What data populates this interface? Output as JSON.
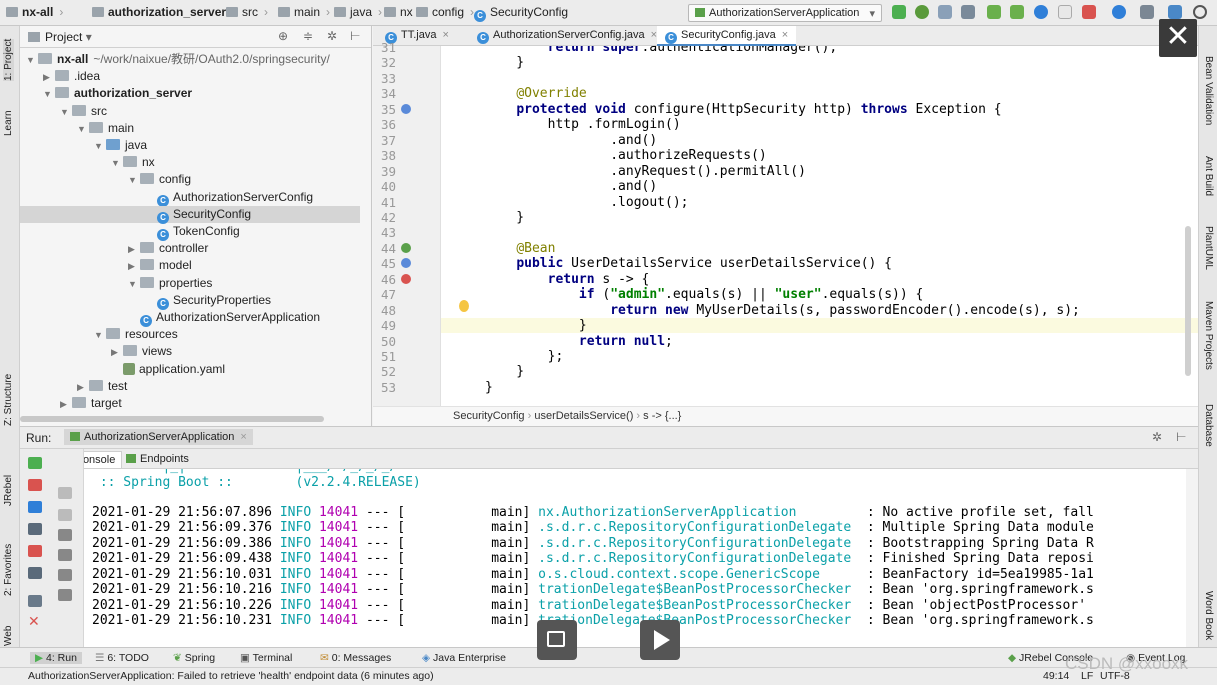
{
  "breadcrumb": [
    "nx-all",
    "authorization_server",
    "src",
    "main",
    "java",
    "nx",
    "config",
    "SecurityConfig"
  ],
  "run_config": "AuthorizationServerApplication",
  "project_panel": {
    "title": "Project",
    "tree": [
      {
        "label": "nx-all",
        "extra": "~/work/naixue/教研/OAuth2.0/springsecurity/",
        "indent": 0,
        "arrow": "▼",
        "icon": "folder",
        "bold": true
      },
      {
        "label": ".idea",
        "indent": 1,
        "arrow": "▶",
        "icon": "folder"
      },
      {
        "label": "authorization_server",
        "indent": 1,
        "arrow": "▼",
        "icon": "folder",
        "bold": true
      },
      {
        "label": "src",
        "indent": 2,
        "arrow": "▼",
        "icon": "folder"
      },
      {
        "label": "main",
        "indent": 3,
        "arrow": "▼",
        "icon": "folder"
      },
      {
        "label": "java",
        "indent": 4,
        "arrow": "▼",
        "icon": "folder-blue"
      },
      {
        "label": "nx",
        "indent": 5,
        "arrow": "▼",
        "icon": "folder"
      },
      {
        "label": "config",
        "indent": 6,
        "arrow": "▼",
        "icon": "folder"
      },
      {
        "label": "AuthorizationServerConfig",
        "indent": 7,
        "arrow": "",
        "icon": "class"
      },
      {
        "label": "SecurityConfig",
        "indent": 7,
        "arrow": "",
        "icon": "class",
        "selected": true
      },
      {
        "label": "TokenConfig",
        "indent": 7,
        "arrow": "",
        "icon": "class"
      },
      {
        "label": "controller",
        "indent": 6,
        "arrow": "▶",
        "icon": "folder"
      },
      {
        "label": "model",
        "indent": 6,
        "arrow": "▶",
        "icon": "folder"
      },
      {
        "label": "properties",
        "indent": 6,
        "arrow": "▼",
        "icon": "folder"
      },
      {
        "label": "SecurityProperties",
        "indent": 7,
        "arrow": "",
        "icon": "class"
      },
      {
        "label": "AuthorizationServerApplication",
        "indent": 6,
        "arrow": "",
        "icon": "class"
      },
      {
        "label": "resources",
        "indent": 4,
        "arrow": "▼",
        "icon": "folder"
      },
      {
        "label": "views",
        "indent": 5,
        "arrow": "▶",
        "icon": "folder"
      },
      {
        "label": "application.yaml",
        "indent": 5,
        "arrow": "",
        "icon": "yaml"
      },
      {
        "label": "test",
        "indent": 3,
        "arrow": "▶",
        "icon": "folder"
      },
      {
        "label": "target",
        "indent": 2,
        "arrow": "▶",
        "icon": "folder"
      }
    ]
  },
  "editor_tabs": [
    {
      "label": "TT.java",
      "active": false
    },
    {
      "label": "AuthorizationServerConfig.java",
      "active": false
    },
    {
      "label": "SecurityConfig.java",
      "active": true
    }
  ],
  "code_lines": [
    {
      "n": "31",
      "html": "        <span class='kw'>return super</span>.authenticationManager();"
    },
    {
      "n": "32",
      "html": "    }"
    },
    {
      "n": "33",
      "html": ""
    },
    {
      "n": "34",
      "html": "    <span class='an'>@Override</span>"
    },
    {
      "n": "35",
      "html": "    <span class='kw'>protected void</span> configure(HttpSecurity http) <span class='kw'>throws</span> Exception {"
    },
    {
      "n": "36",
      "html": "        http .formLogin()"
    },
    {
      "n": "37",
      "html": "                .and()"
    },
    {
      "n": "38",
      "html": "                .authorizeRequests()"
    },
    {
      "n": "39",
      "html": "                .anyRequest().permitAll()"
    },
    {
      "n": "40",
      "html": "                .and()"
    },
    {
      "n": "41",
      "html": "                .logout();"
    },
    {
      "n": "42",
      "html": "    }"
    },
    {
      "n": "43",
      "html": ""
    },
    {
      "n": "44",
      "html": "    <span class='an'>@Bean</span>"
    },
    {
      "n": "45",
      "html": "    <span class='kw'>public</span> UserDetailsService userDetailsService() {"
    },
    {
      "n": "46",
      "html": "        <span class='kw'>return</span> s -> {"
    },
    {
      "n": "47",
      "html": "            <span class='kw'>if</span> (<span class='st'>\"admin\"</span>.equals(s) || <span class='st'>\"user\"</span>.equals(s)) {"
    },
    {
      "n": "48",
      "html": "                <span class='kw'>return new</span> MyUserDetails(s, passwordEncoder().encode(s), s);"
    },
    {
      "n": "49",
      "html": "            }"
    },
    {
      "n": "50",
      "html": "            <span class='kw'>return null</span>;"
    },
    {
      "n": "51",
      "html": "        };"
    },
    {
      "n": "52",
      "html": "    }"
    },
    {
      "n": "53",
      "html": "}"
    }
  ],
  "editor_breadcrumb": [
    "SecurityConfig",
    "userDetailsService()",
    "s -> {...}"
  ],
  "run_panel": {
    "label": "Run:",
    "config": "AuthorizationServerApplication",
    "tabs": [
      "Console",
      "Endpoints"
    ],
    "banner_line": "=========|_|==============|___/=/_/_/_/",
    "boot_line": " :: Spring Boot ::        (v2.2.4.RELEASE)",
    "logs": [
      {
        "ts": "2021-01-29 21:56:07.896",
        "lvl": "INFO",
        "pid": "14041",
        "sep": "--- [",
        "thread": "main]",
        "logger": "nx.AuthorizationServerApplication        ",
        "msg": ": No active profile set, fall"
      },
      {
        "ts": "2021-01-29 21:56:09.376",
        "lvl": "INFO",
        "pid": "14041",
        "sep": "--- [",
        "thread": "main]",
        "logger": ".s.d.r.c.RepositoryConfigurationDelegate ",
        "msg": ": Multiple Spring Data module"
      },
      {
        "ts": "2021-01-29 21:56:09.386",
        "lvl": "INFO",
        "pid": "14041",
        "sep": "--- [",
        "thread": "main]",
        "logger": ".s.d.r.c.RepositoryConfigurationDelegate ",
        "msg": ": Bootstrapping Spring Data R"
      },
      {
        "ts": "2021-01-29 21:56:09.438",
        "lvl": "INFO",
        "pid": "14041",
        "sep": "--- [",
        "thread": "main]",
        "logger": ".s.d.r.c.RepositoryConfigurationDelegate ",
        "msg": ": Finished Spring Data reposi"
      },
      {
        "ts": "2021-01-29 21:56:10.031",
        "lvl": "INFO",
        "pid": "14041",
        "sep": "--- [",
        "thread": "main]",
        "logger": "o.s.cloud.context.scope.GenericScope     ",
        "msg": ": BeanFactory id=5ea19985-1a1"
      },
      {
        "ts": "2021-01-29 21:56:10.216",
        "lvl": "INFO",
        "pid": "14041",
        "sep": "--- [",
        "thread": "main]",
        "logger": "trationDelegate$BeanPostProcessorChecker ",
        "msg": ": Bean 'org.springframework.s"
      },
      {
        "ts": "2021-01-29 21:56:10.226",
        "lvl": "INFO",
        "pid": "14041",
        "sep": "--- [",
        "thread": "main]",
        "logger": "trationDelegate$BeanPostProcessorChecker ",
        "msg": ": Bean 'objectPostProcessor'"
      },
      {
        "ts": "2021-01-29 21:56:10.231",
        "lvl": "INFO",
        "pid": "14041",
        "sep": "--- [",
        "thread": "main]",
        "logger": "trationDelegate$BeanPostProcessorChecker ",
        "msg": ": Bean 'org.springframework.s"
      }
    ]
  },
  "left_strip": [
    "1: Project",
    "Learn",
    "Z: Structure",
    "JRebel",
    "2: Favorites",
    "Web"
  ],
  "right_strip": [
    "Bean Validation",
    "Ant Build",
    "PlantUML",
    "Maven Projects",
    "Database",
    "Word Book"
  ],
  "status_tabs": [
    "4: Run",
    "6: TODO",
    "Spring",
    "Terminal",
    "0: Messages",
    "Java Enterprise"
  ],
  "status_right": [
    "JRebel Console",
    "Event Log"
  ],
  "bottom_message": "AuthorizationServerApplication: Failed to retrieve 'health' endpoint data (6 minutes ago)",
  "position": "49:14",
  "line_sep": "LF",
  "encoding": "UTF-8",
  "watermark": "CSDN @xxooxk",
  "colors": {
    "accent": "#4a88c7",
    "keyword": "#000080",
    "string": "#008000",
    "annotation": "#808000",
    "log_cyan": "#0aa0a8",
    "log_red": "#b00000"
  }
}
